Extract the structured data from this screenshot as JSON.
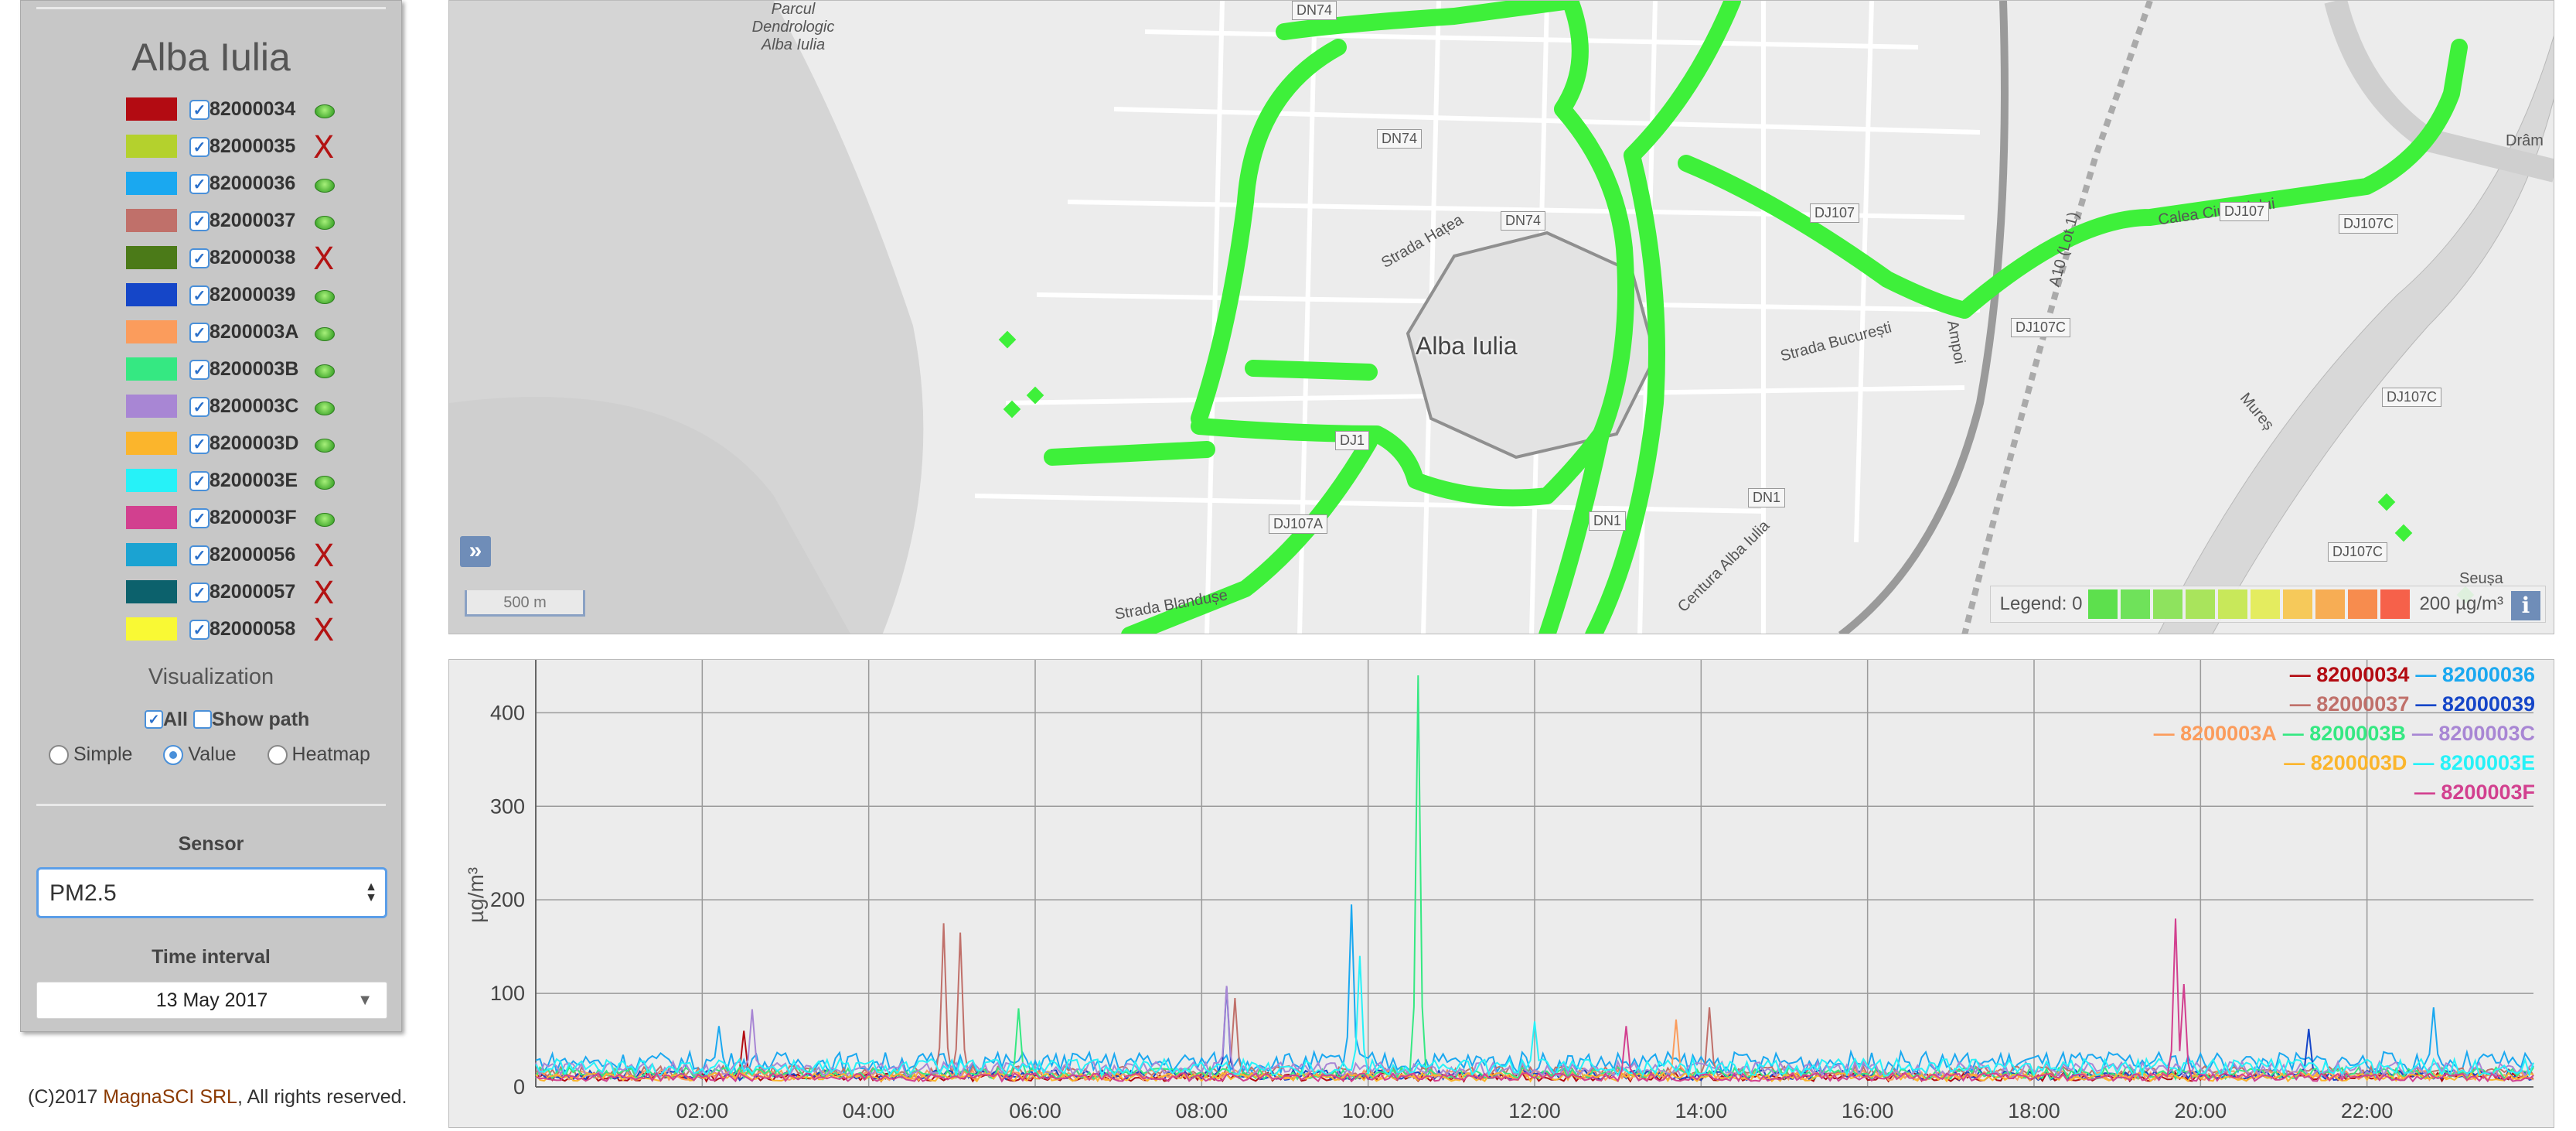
{
  "sidebar": {
    "city": "Alba Iulia",
    "sensors": [
      {
        "id": "82000034",
        "color": "#b30b12",
        "checked": true,
        "status": "ok"
      },
      {
        "id": "82000035",
        "color": "#b4d12d",
        "checked": true,
        "status": "x"
      },
      {
        "id": "82000036",
        "color": "#1aa8f0",
        "checked": true,
        "status": "ok"
      },
      {
        "id": "82000037",
        "color": "#c0706a",
        "checked": true,
        "status": "ok"
      },
      {
        "id": "82000038",
        "color": "#4b7a18",
        "checked": true,
        "status": "x"
      },
      {
        "id": "82000039",
        "color": "#1546c8",
        "checked": true,
        "status": "ok"
      },
      {
        "id": "8200003A",
        "color": "#fb9c5c",
        "checked": true,
        "status": "ok"
      },
      {
        "id": "8200003B",
        "color": "#35e882",
        "checked": true,
        "status": "ok"
      },
      {
        "id": "8200003C",
        "color": "#a886d4",
        "checked": true,
        "status": "ok"
      },
      {
        "id": "8200003D",
        "color": "#fbb52c",
        "checked": true,
        "status": "ok"
      },
      {
        "id": "8200003E",
        "color": "#26f2f8",
        "checked": true,
        "status": "ok"
      },
      {
        "id": "8200003F",
        "color": "#d2408f",
        "checked": true,
        "status": "ok"
      },
      {
        "id": "82000056",
        "color": "#1ba3d2",
        "checked": true,
        "status": "x"
      },
      {
        "id": "82000057",
        "color": "#0c616c",
        "checked": true,
        "status": "x"
      },
      {
        "id": "82000058",
        "color": "#f9f934",
        "checked": true,
        "status": "x"
      }
    ],
    "status_x_glyph": "X",
    "visualization": {
      "title": "Visualization",
      "all_label": "All",
      "show_path_label": "Show path",
      "all_checked": true,
      "show_path_checked": false,
      "modes": [
        "Simple",
        "Value",
        "Heatmap"
      ],
      "selected_mode": "Value"
    },
    "sensor_select": {
      "label": "Sensor",
      "value": "PM2.5"
    },
    "time_interval": {
      "label": "Time interval",
      "value": "13 May 2017"
    }
  },
  "footer": {
    "prefix": "(C)2017 ",
    "company": "MagnaSCI SRL",
    "suffix": ", All rights reserved."
  },
  "map": {
    "city_label": "Alba Iulia",
    "labels": [
      "Parcul Dendrologic Alba Iulia",
      "Strada Hațea",
      "Strada București",
      "Strada Blandușe",
      "Centura Alba Iulia",
      "Mureș",
      "Ampoi",
      "Calea Ciugudului",
      "Seușa",
      "Drâm",
      "A10 (Lot 1)"
    ],
    "road_labels": [
      "DN74",
      "DN74",
      "DN74",
      "DN1",
      "DJ107A",
      "DJ107",
      "DJ107C",
      "DJ107C",
      "DJ107C",
      "DJ107",
      "DJ1",
      "DN1",
      "DJ107C"
    ],
    "expand_button": "»",
    "scale_label": "500 m",
    "legend": {
      "min_label": "Legend: 0",
      "max_label": "200 µg/m³",
      "colors": [
        "#5de04d",
        "#6fe25a",
        "#8ee35e",
        "#a9e45c",
        "#c8e85a",
        "#e4ec5f",
        "#f6c95a",
        "#f7ad54",
        "#f78c4e",
        "#f6614a"
      ]
    },
    "info_button": "i",
    "track_color": "#3ef03a"
  },
  "chart_data": {
    "type": "line",
    "ylabel": "µg/m³",
    "ylim": [
      0,
      440
    ],
    "y_ticks": [
      0,
      100,
      200,
      300,
      400
    ],
    "x_ticks": [
      "02:00",
      "04:00",
      "06:00",
      "08:00",
      "10:00",
      "12:00",
      "14:00",
      "16:00",
      "18:00",
      "20:00",
      "22:00"
    ],
    "x_range_hours": [
      0,
      24
    ],
    "grid": true,
    "legend_placement": "top-right",
    "series": [
      {
        "name": "82000034",
        "color": "#b30b12",
        "baseline": 10,
        "spikes": [
          [
            2.5,
            50
          ]
        ]
      },
      {
        "name": "82000036",
        "color": "#1aa8f0",
        "baseline": 25,
        "spikes": [
          [
            2.2,
            40
          ],
          [
            9.8,
            170
          ],
          [
            22.8,
            60
          ]
        ]
      },
      {
        "name": "82000037",
        "color": "#c0706a",
        "baseline": 15,
        "spikes": [
          [
            4.9,
            160
          ],
          [
            5.1,
            150
          ],
          [
            8.4,
            80
          ],
          [
            14.1,
            70
          ]
        ]
      },
      {
        "name": "82000039",
        "color": "#1546c8",
        "baseline": 12,
        "spikes": [
          [
            8.3,
            95
          ],
          [
            21.3,
            50
          ]
        ]
      },
      {
        "name": "8200003A",
        "color": "#fb9c5c",
        "baseline": 12,
        "spikes": [
          [
            13.7,
            60
          ]
        ]
      },
      {
        "name": "8200003B",
        "color": "#35e882",
        "baseline": 14,
        "spikes": [
          [
            10.6,
            430
          ],
          [
            5.8,
            70
          ]
        ]
      },
      {
        "name": "8200003C",
        "color": "#a886d4",
        "baseline": 18,
        "spikes": [
          [
            2.6,
            65
          ],
          [
            8.3,
            90
          ]
        ]
      },
      {
        "name": "8200003D",
        "color": "#fbb52c",
        "baseline": 10,
        "spikes": []
      },
      {
        "name": "8200003E",
        "color": "#26f2f8",
        "baseline": 20,
        "spikes": [
          [
            9.9,
            120
          ],
          [
            12.0,
            50
          ]
        ]
      },
      {
        "name": "8200003F",
        "color": "#d2408f",
        "baseline": 10,
        "spikes": [
          [
            19.7,
            170
          ],
          [
            19.8,
            100
          ],
          [
            13.1,
            55
          ]
        ]
      }
    ]
  }
}
